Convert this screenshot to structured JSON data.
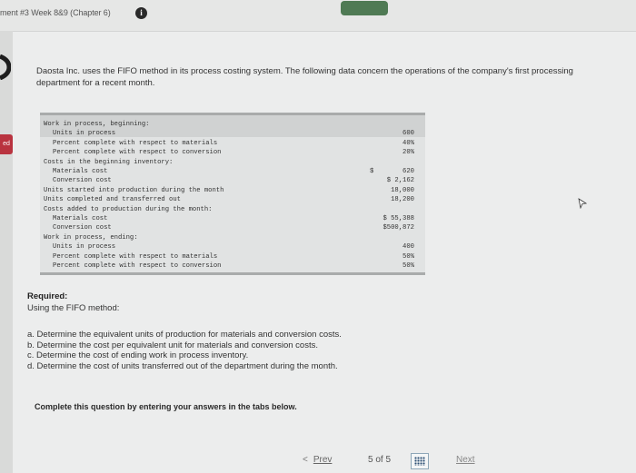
{
  "header": {
    "assignment_title": "ment #3 Week 8&9 (Chapter 6)",
    "info_icon": "i"
  },
  "sidebar": {
    "tab_label": "ed"
  },
  "problem": {
    "intro": "Daosta Inc. uses the FIFO method in its process costing system. The following data concern the operations of the company's first processing department for a recent month.",
    "table_rows": [
      {
        "label": "Work in process, beginning:",
        "currency": "",
        "value": "",
        "indent": 0
      },
      {
        "label": "Units in process",
        "currency": "",
        "value": "600",
        "indent": 1
      },
      {
        "label": "Percent complete with respect to materials",
        "currency": "",
        "value": "40%",
        "indent": 1
      },
      {
        "label": "Percent complete with respect to conversion",
        "currency": "",
        "value": "20%",
        "indent": 1
      },
      {
        "label": "Costs in the beginning inventory:",
        "currency": "",
        "value": "",
        "indent": 0
      },
      {
        "label": "Materials cost",
        "currency": "$",
        "value": "620",
        "indent": 1
      },
      {
        "label": "Conversion cost",
        "currency": "",
        "value": "$ 2,162",
        "indent": 1
      },
      {
        "label": "Units started into production during the month",
        "currency": "",
        "value": "18,000",
        "indent": 0
      },
      {
        "label": "Units completed and transferred out",
        "currency": "",
        "value": "18,200",
        "indent": 0
      },
      {
        "label": "Costs added to production during the month:",
        "currency": "",
        "value": "",
        "indent": 0
      },
      {
        "label": "Materials cost",
        "currency": "",
        "value": "$ 55,388",
        "indent": 1
      },
      {
        "label": "Conversion cost",
        "currency": "",
        "value": "$500,872",
        "indent": 1
      },
      {
        "label": "Work in process, ending:",
        "currency": "",
        "value": "",
        "indent": 0
      },
      {
        "label": "Units in process",
        "currency": "",
        "value": "400",
        "indent": 1
      },
      {
        "label": "Percent complete with respect to materials",
        "currency": "",
        "value": "50%",
        "indent": 1
      },
      {
        "label": "Percent complete with respect to conversion",
        "currency": "",
        "value": "50%",
        "indent": 1
      }
    ],
    "required_label": "Required:",
    "method_label": "Using the FIFO method:",
    "tasks": [
      "a. Determine the equivalent units of production for materials and conversion costs.",
      "b. Determine the cost per equivalent unit for materials and conversion costs.",
      "c. Determine the cost of ending work in process inventory.",
      "d. Determine the cost of units transferred out of the department during the month."
    ],
    "complete_note": "Complete this question by entering your answers in the tabs below."
  },
  "footer": {
    "prev_chevron": "<",
    "prev_label": "Prev",
    "page_current": "5",
    "page_of": "of",
    "page_total": "5",
    "next_label": "Next"
  },
  "colors": {
    "accent_red": "#b9333f",
    "saved_green": "#4f7a54"
  }
}
